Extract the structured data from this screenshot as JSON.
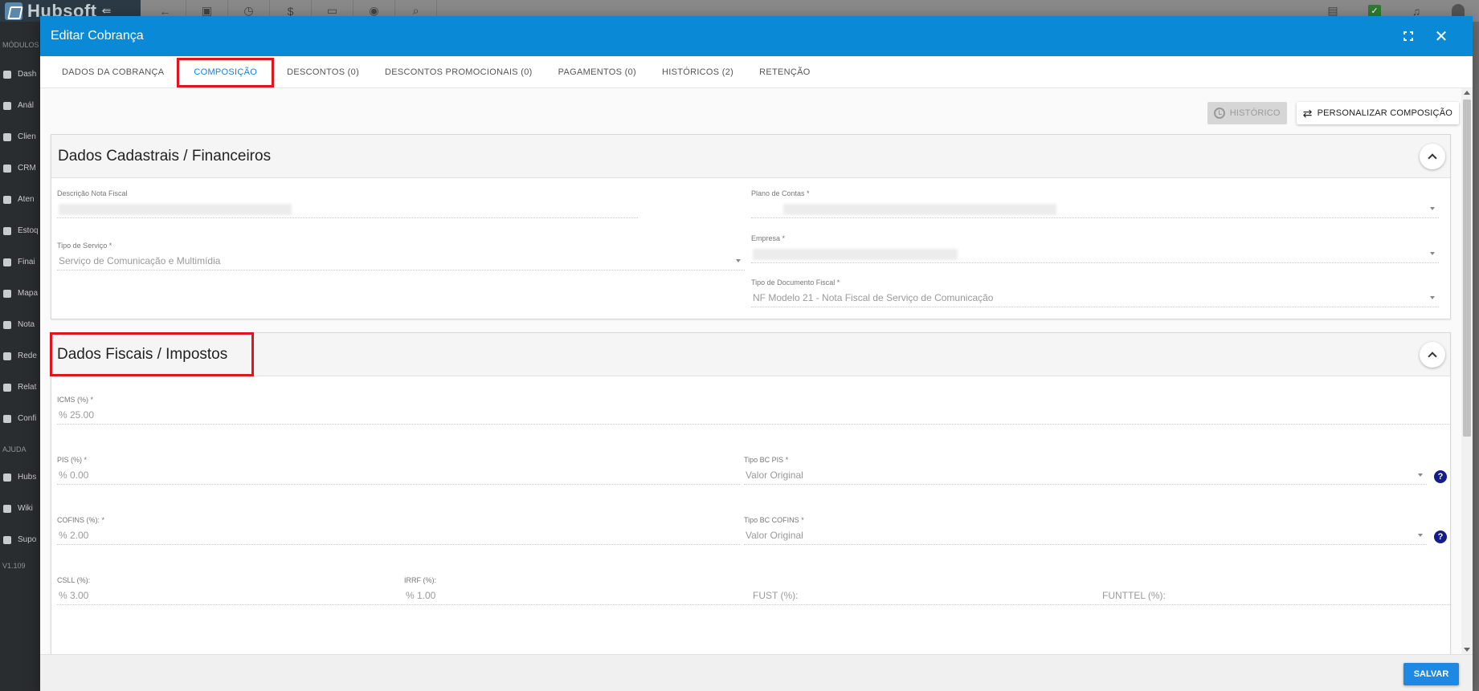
{
  "app": {
    "brand": "Hubsoft",
    "sidebar": {
      "section_modules": "MÓDULOS",
      "section_help": "AJUDA",
      "items": [
        "Dash",
        "Anál",
        "Clien",
        "CRM",
        "Aten",
        "Estoq",
        "Finai",
        "Mapa",
        "Nota",
        "Rede",
        "Relat",
        "Confi"
      ],
      "help_items": [
        "Hubs",
        "Wiki",
        "Supo"
      ],
      "version": "V1.109"
    }
  },
  "modal": {
    "title": "Editar Cobrança",
    "tabs": [
      {
        "label": "DADOS DA COBRANÇA"
      },
      {
        "label": "COMPOSIÇÃO"
      },
      {
        "label": "DESCONTOS (0)"
      },
      {
        "label": "DESCONTOS PROMOCIONAIS (0)"
      },
      {
        "label": "PAGAMENTOS (0)"
      },
      {
        "label": "HISTÓRICOS (2)"
      },
      {
        "label": "RETENÇÃO"
      }
    ],
    "actions": {
      "historico": "HISTÓRICO",
      "personalizar": "PERSONALIZAR COMPOSIÇÃO"
    },
    "cadastrais": {
      "title": "Dados Cadastrais / Financeiros",
      "descricao_label": "Descrição Nota Fiscal",
      "plano_label": "Plano de Contas",
      "tipo_servico_label": "Tipo de Serviço",
      "tipo_servico_value": "Serviço de Comunicação e Multimídia",
      "empresa_label": "Empresa",
      "tipo_doc_label": "Tipo de Documento Fiscal",
      "tipo_doc_value": "NF Modelo 21 - Nota Fiscal de Serviço de Comunicação"
    },
    "fiscais": {
      "title": "Dados Fiscais / Impostos",
      "icms_label": "ICMS (%)",
      "icms_value": "% 25.00",
      "pis_label": "PIS (%)",
      "pis_value": "% 0.00",
      "tipo_bc_pis_label": "Tipo BC PIS",
      "tipo_bc_pis_value": "Valor Original",
      "cofins_label": "COFINS (%):",
      "cofins_value": "% 2.00",
      "tipo_bc_cofins_label": "Tipo BC COFINS",
      "tipo_bc_cofins_value": "Valor Original",
      "csll_label": "CSLL (%):",
      "csll_value": "% 3.00",
      "irrf_label": "IRRF (%):",
      "irrf_value": "% 1.00",
      "fust_label": "FUST (%):",
      "funttel_label": "FUNTTEL (%):"
    },
    "save": "SALVAR"
  }
}
